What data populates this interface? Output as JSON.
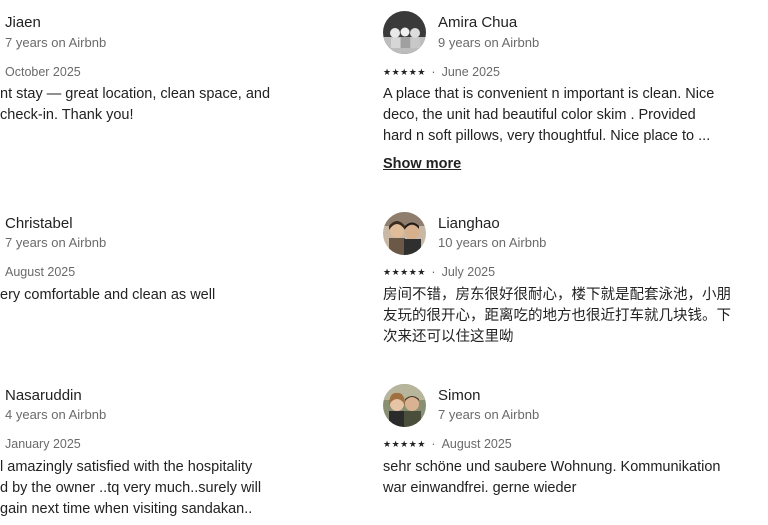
{
  "reviews": [
    {
      "name": "Jiaen",
      "tenure": "7 years on Airbnb",
      "date": "October 2025",
      "lines": [
        "nt stay — great location, clean space, and",
        " check-in. Thank you!"
      ]
    },
    {
      "name": "Amira Chua",
      "tenure": "9 years on Airbnb",
      "date": "June 2025",
      "lines": [
        "A place that is convenient n important is clean. Nice",
        "deco, the unit had beautiful color skim . Provided",
        "hard n soft pillows, very thoughtful. Nice place to ..."
      ],
      "show_more": "Show more"
    },
    {
      "name": "Christabel",
      "tenure": "7 years on Airbnb",
      "date": "August 2025",
      "lines": [
        "ery comfortable and clean as well"
      ]
    },
    {
      "name": "Lianghao",
      "tenure": "10 years on Airbnb",
      "date": "July 2025",
      "lines": [
        "房间不错，房东很好很耐心，楼下就是配套泳池，小朋",
        "友玩的很开心，距离吃的地方也很近打车就几块钱。下",
        "次来还可以住这里呦"
      ]
    },
    {
      "name": "Nasaruddin",
      "tenure": "4 years on Airbnb",
      "date": "January 2025",
      "lines": [
        "l amazingly satisfied with the hospitality",
        "d by the owner ..tq very much..surely will",
        "gain next time when visiting sandakan.."
      ]
    },
    {
      "name": "Simon",
      "tenure": "7 years on Airbnb",
      "date": "August 2025",
      "lines": [
        "sehr schöne und saubere Wohnung. Kommunikation",
        "war einwandfrei. gerne wieder"
      ]
    }
  ],
  "rating_glyph": "★",
  "separator": "·"
}
